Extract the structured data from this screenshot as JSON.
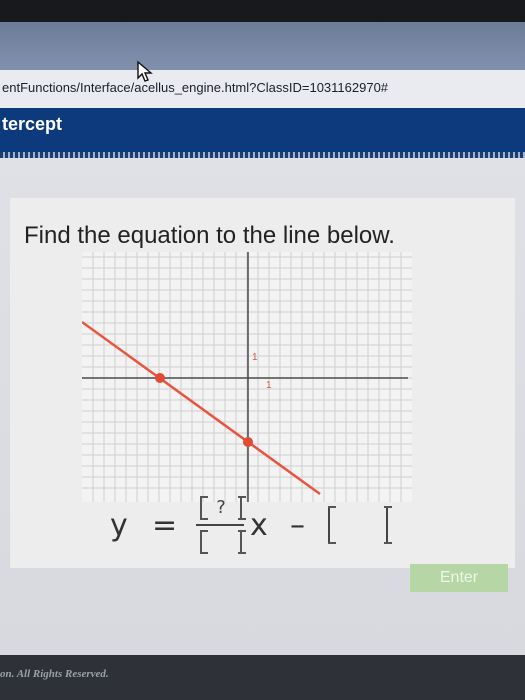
{
  "browser": {
    "url": "entFunctions/Interface/acellus_engine.html?ClassID=1031162970#"
  },
  "header": {
    "title": "tercept"
  },
  "question": {
    "prompt": "Find the equation to the line below."
  },
  "graph": {
    "axis_label_y": "1",
    "axis_label_x": "1",
    "line_color": "#e8553f",
    "point_color": "#e14a33",
    "points": [
      [
        -8,
        0
      ],
      [
        0,
        -6
      ]
    ]
  },
  "equation": {
    "lhs": "y",
    "equals": "=",
    "numerator_placeholder": "?",
    "variable": "x",
    "operator": "–"
  },
  "actions": {
    "enter_label": "Enter",
    "enter_color": "#b7d6a5"
  },
  "footer": {
    "text": "on. All Rights Reserved."
  }
}
